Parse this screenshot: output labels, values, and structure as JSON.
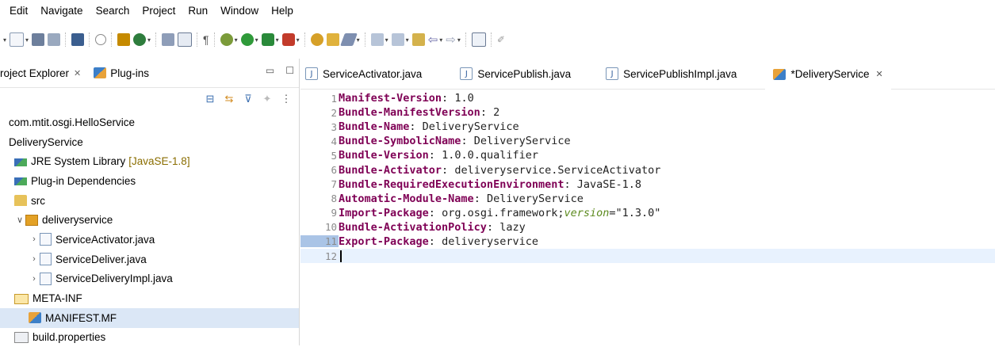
{
  "menu": [
    "Edit",
    "Navigate",
    "Search",
    "Project",
    "Run",
    "Window",
    "Help"
  ],
  "left_panel": {
    "tabs": [
      {
        "label": "roject Explorer",
        "close": "✕",
        "active": true
      },
      {
        "label": "Plug-ins",
        "active": false
      }
    ],
    "window_controls": {
      "minimize": "▭",
      "maximize": "☐"
    },
    "tree": [
      {
        "label": "com.mtit.osgi.HelloService",
        "icon": "project-icon",
        "indent": 0,
        "twisty": "",
        "deco": ""
      },
      {
        "label": "DeliveryService",
        "icon": "project-icon",
        "indent": 0,
        "twisty": "",
        "deco": ""
      },
      {
        "label": "JRE System Library",
        "deco": "[JavaSE-1.8]",
        "icon": "library-icon",
        "indent": 1,
        "twisty": ""
      },
      {
        "label": "Plug-in Dependencies",
        "icon": "library-icon",
        "indent": 1,
        "twisty": "",
        "deco": ""
      },
      {
        "label": "src",
        "icon": "source-folder-icon",
        "indent": 1,
        "twisty": "",
        "deco": ""
      },
      {
        "label": "deliveryservice",
        "icon": "package-icon",
        "indent": 1,
        "twisty": "∨",
        "deco": ""
      },
      {
        "label": "ServiceActivator.java",
        "icon": "java-file-icon",
        "indent": 2,
        "twisty": "›",
        "deco": ""
      },
      {
        "label": "ServiceDeliver.java",
        "icon": "java-interface-icon",
        "indent": 2,
        "twisty": "›",
        "deco": ""
      },
      {
        "label": "ServiceDeliveryImpl.java",
        "icon": "java-file-icon",
        "indent": 2,
        "twisty": "›",
        "deco": ""
      },
      {
        "label": "META-INF",
        "icon": "folder-icon",
        "indent": 1,
        "twisty": "",
        "deco": ""
      },
      {
        "label": "MANIFEST.MF",
        "icon": "manifest-icon",
        "indent": 2,
        "twisty": "",
        "deco": "",
        "selected": true
      },
      {
        "label": "build.properties",
        "icon": "properties-file-icon",
        "indent": 1,
        "twisty": "",
        "deco": ""
      }
    ]
  },
  "editor": {
    "tabs": [
      {
        "label": "ServiceActivator.java",
        "icon": "java-file-icon",
        "active": false
      },
      {
        "label": "ServicePublish.java",
        "icon": "java-file-icon",
        "active": false
      },
      {
        "label": "ServicePublishImpl.java",
        "icon": "java-file-icon",
        "active": false
      },
      {
        "label": "*DeliveryService",
        "icon": "manifest-icon",
        "active": true,
        "close": "✕"
      }
    ],
    "lines": [
      {
        "n": "1",
        "key": "Manifest-Version",
        "sep": ": ",
        "value": "1.0"
      },
      {
        "n": "2",
        "key": "Bundle-ManifestVersion",
        "sep": ": ",
        "value": "2"
      },
      {
        "n": "3",
        "key": "Bundle-Name",
        "sep": ": ",
        "value": "DeliveryService"
      },
      {
        "n": "4",
        "key": "Bundle-SymbolicName",
        "sep": ": ",
        "value": "DeliveryService"
      },
      {
        "n": "5",
        "key": "Bundle-Version",
        "sep": ": ",
        "value": "1.0.0.qualifier"
      },
      {
        "n": "6",
        "key": "Bundle-Activator",
        "sep": ": ",
        "value": "deliveryservice.ServiceActivator"
      },
      {
        "n": "7",
        "key": "Bundle-RequiredExecutionEnvironment",
        "sep": ": ",
        "value": "JavaSE-1.8"
      },
      {
        "n": "8",
        "key": "Automatic-Module-Name",
        "sep": ": ",
        "value": "DeliveryService"
      },
      {
        "n": "9",
        "key": "Import-Package",
        "sep": ": ",
        "value": "org.osgi.framework;",
        "attr": "version",
        "attr_rest": "=\"1.3.0\""
      },
      {
        "n": "10",
        "key": "Bundle-ActivationPolicy",
        "sep": ": ",
        "value": "lazy"
      },
      {
        "n": "11",
        "key": "Export-Package",
        "sep": ": ",
        "value": "deliveryservice",
        "marked": true
      },
      {
        "n": "12",
        "key": "",
        "sep": "",
        "value": "",
        "current": true
      }
    ]
  },
  "colors": {
    "keyword": "#7f0055",
    "attribute": "#5c8a1e",
    "selection": "#dbe7f6",
    "current_line": "#e8f2fe"
  }
}
